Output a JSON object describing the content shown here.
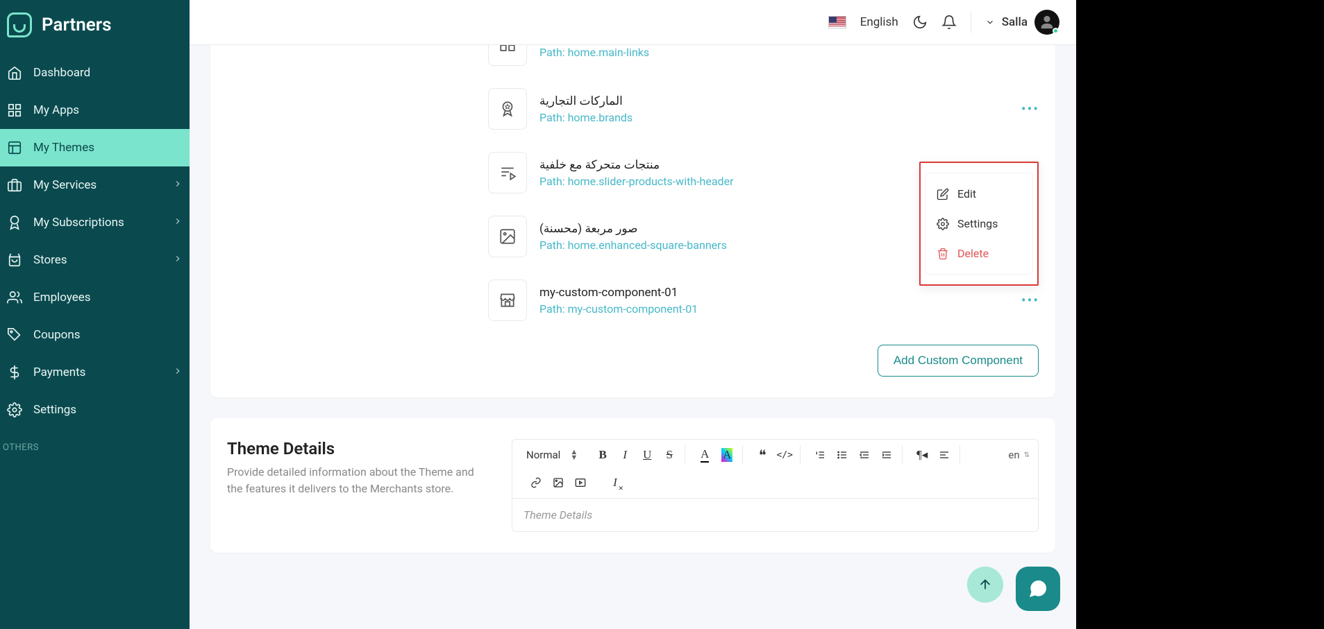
{
  "brand": "Partners",
  "sidebar": {
    "items": [
      {
        "label": "Dashboard"
      },
      {
        "label": "My Apps"
      },
      {
        "label": "My Themes"
      },
      {
        "label": "My Services"
      },
      {
        "label": "My Subscriptions"
      },
      {
        "label": "Stores"
      },
      {
        "label": "Employees"
      },
      {
        "label": "Coupons"
      },
      {
        "label": "Payments"
      },
      {
        "label": "Settings"
      }
    ],
    "others_label": "OTHERS"
  },
  "topbar": {
    "language": "English",
    "username": "Salla"
  },
  "components": [
    {
      "title": "",
      "path": "Path: home.main-links"
    },
    {
      "title": "الماركات التجارية",
      "path": "Path: home.brands"
    },
    {
      "title": "منتجات متحركة مع خلفية",
      "path": "Path: home.slider-products-with-header"
    },
    {
      "title": "صور مربعة (محسنة)",
      "path": "Path: home.enhanced-square-banners"
    },
    {
      "title": "my-custom-component-01",
      "path": "Path: my-custom-component-01"
    }
  ],
  "dropdown": {
    "edit": "Edit",
    "settings": "Settings",
    "delete": "Delete"
  },
  "add_button": "Add Custom Component",
  "details": {
    "title": "Theme Details",
    "description": "Provide detailed information about the Theme and the features it delivers to the Merchants store."
  },
  "editor": {
    "format": "Normal",
    "lang": "en",
    "placeholder": "Theme Details"
  }
}
